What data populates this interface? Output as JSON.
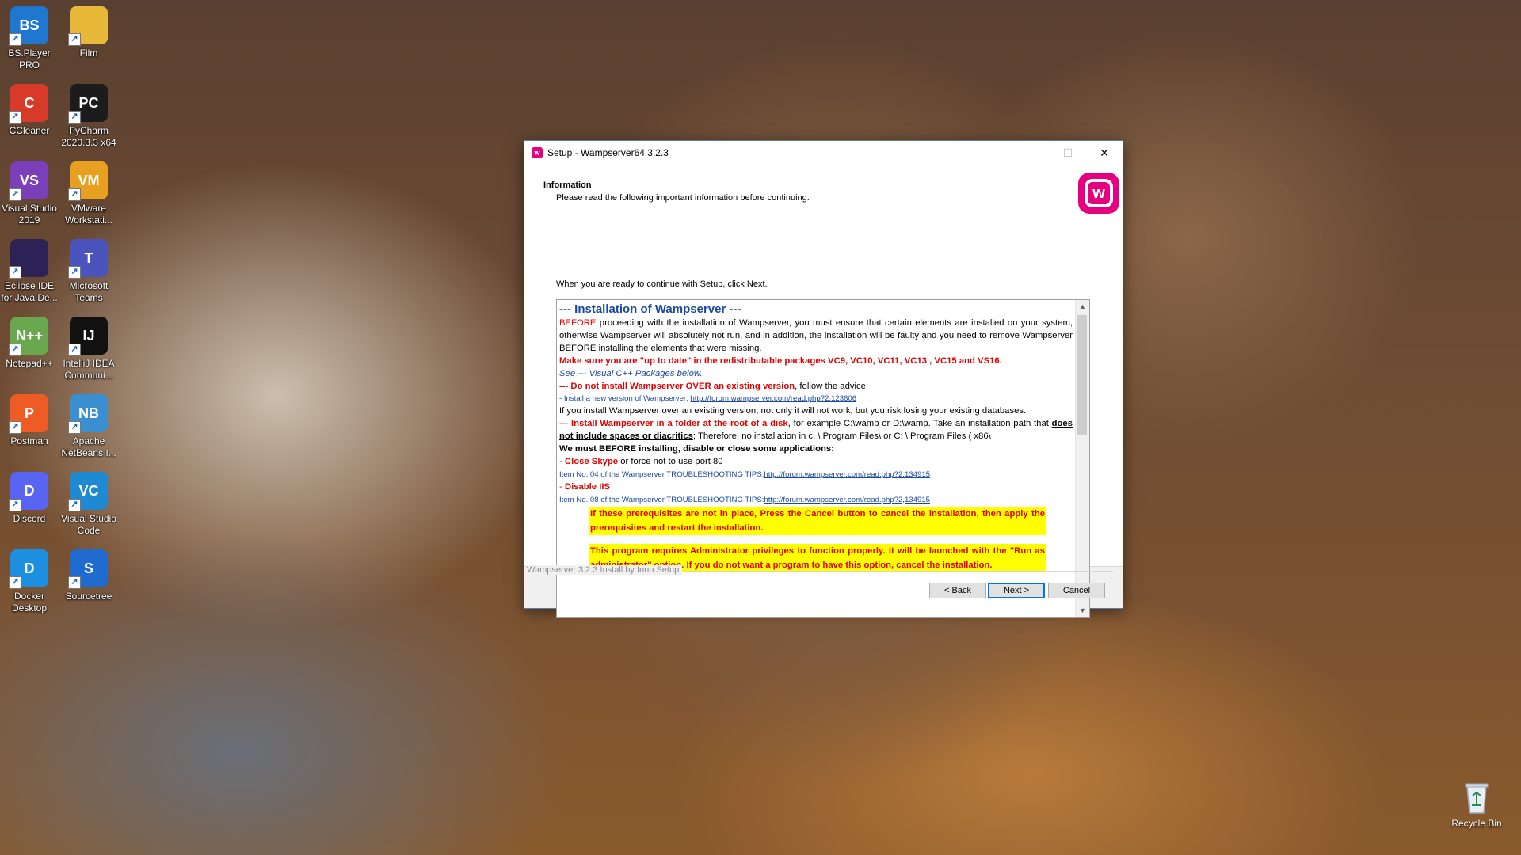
{
  "desktop": {
    "icons": [
      {
        "label": "BS.Player PRO",
        "glyph": "BS",
        "color": "#1f77d0"
      },
      {
        "label": "Film",
        "glyph": "",
        "color": "#e8b83a"
      },
      {
        "label": "CCleaner",
        "glyph": "C",
        "color": "#d83a2a"
      },
      {
        "label": "PyCharm 2020.3.3 x64",
        "glyph": "PC",
        "color": "#1c1c1c"
      },
      {
        "label": "Visual Studio 2019",
        "glyph": "VS",
        "color": "#7b3fb9"
      },
      {
        "label": "VMware Workstati...",
        "glyph": "VM",
        "color": "#e8a020"
      },
      {
        "label": "Eclipse IDE for Java De...",
        "glyph": "",
        "color": "#2c2255"
      },
      {
        "label": "Microsoft Teams",
        "glyph": "T",
        "color": "#4b53bc"
      },
      {
        "label": "Notepad++",
        "glyph": "N++",
        "color": "#6aa84f"
      },
      {
        "label": "IntelliJ IDEA Communi...",
        "glyph": "IJ",
        "color": "#111111"
      },
      {
        "label": "Postman",
        "glyph": "P",
        "color": "#ef5b25"
      },
      {
        "label": "Apache NetBeans I...",
        "glyph": "NB",
        "color": "#3a8fd0"
      },
      {
        "label": "Discord",
        "glyph": "D",
        "color": "#5865f2"
      },
      {
        "label": "Visual Studio Code",
        "glyph": "VC",
        "color": "#1f8ad2"
      },
      {
        "label": "Docker Desktop",
        "glyph": "D",
        "color": "#1d8fe0"
      },
      {
        "label": "Sourcetree",
        "glyph": "S",
        "color": "#1f6bd0"
      }
    ],
    "recycle_bin": "Recycle Bin"
  },
  "dialog": {
    "title": "Setup - Wampserver64 3.2.3",
    "header_title": "Information",
    "header_subtitle": "Please read the following important information before continuing.",
    "intro": "When you are ready to continue with Setup, click Next.",
    "content": {
      "heading": "--- Installation of Wampserver ---",
      "p1_before": "BEFORE",
      "p1_rest": " proceeding with the installation of Wampserver, you must ensure that certain elements are installed on your system, otherwise Wampserver will absolutely not run, and in addition, the installation will be faulty and you need to remove Wampserver BEFORE installing the elements that were missing.",
      "p2": "Make sure you are \"up to date\" in the redistributable packages VC9, VC10, VC11, VC13 , VC15 and VS16.",
      "p3": "See --- Visual C++ Packages below.",
      "p4_red": "--- Do not install Wampserver OVER an existing version",
      "p4_rest": ", follow the advice:",
      "p5_text": "- Install a new version of Wampserver: ",
      "p5_link": "http://forum.wampserver.com/read.php?2,123606",
      "p6": "If you install Wampserver over an existing version, not only it will not work, but you risk losing your existing databases.",
      "p7_red": "--- Install Wampserver in a folder at the root of a disk",
      "p7_rest1": ", for example C:\\wamp or D:\\wamp. Take an installation path that ",
      "p7_u": "does not include spaces or diacritics",
      "p7_rest2": "; Therefore, no installation in c: \\ Program Files\\ or C: \\ Program Files  ( x86\\",
      "p8": "We must BEFORE installing, disable or close some applications:",
      "p9_dash": "- ",
      "p9_red": "Close Skype",
      "p9_rest": " or force not to use port 80",
      "p10_text": "Item No. 04 of the Wampserver TROUBLESHOOTING TIPS:",
      "p10_link": "http://forum.wampserver.com/read.php?2,134915",
      "p11_dash": "- ",
      "p11_red": "Disable IIS",
      "p12_text": "Item No. 08 of the Wampserver TROUBLESHOOTING TIPS:",
      "p12_link": "http://forum.wampserver.com/read.php?2,134915",
      "warn1": "If these prerequisites are not in place, Press the Cancel button to cancel the installation, then apply the prerequisites and restart the installation.",
      "warn2": "This program requires Administrator privileges to function properly. It will be launched with the \"Run as administrator\" option. If you do not want a program to have this option, cancel the installation."
    },
    "footer_label": "Wampserver 3.2.3 Install by Inno Setup",
    "back_label": "< Back",
    "next_label": "Next >",
    "cancel_label": "Cancel"
  }
}
